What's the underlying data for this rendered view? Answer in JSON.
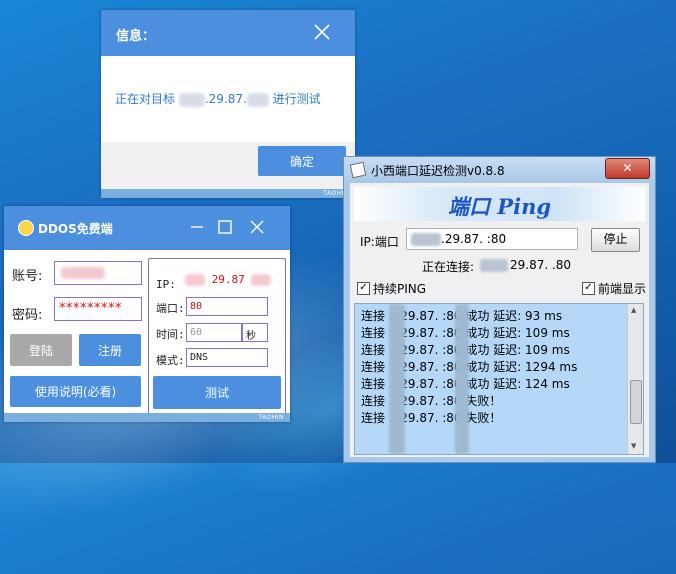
{
  "info_dialog": {
    "title": "信息：",
    "message_prefix": "正在对目标",
    "message_ip": ".29.87.",
    "message_suffix": "进行测试",
    "ok_label": "确定",
    "brand": "TAOHIN"
  },
  "ddos_window": {
    "title": "DDOS免费端",
    "account_label": "账号:",
    "password_label": "密码:",
    "password_value": "*********",
    "login_label": "登陆",
    "register_label": "注册",
    "help_label": "使用说明(必看)",
    "ip_label": "IP:",
    "ip_value": "29.87",
    "port_label": "端口:",
    "port_value": "80",
    "time_label": "时间:",
    "time_value": "60",
    "time_unit": "秒",
    "mode_label": "模式:",
    "mode_value": "DNS",
    "test_label": "测试",
    "brand": "TAOHIN"
  },
  "ping_tool": {
    "title": "小西端口延迟检测v0.8.8",
    "close_label": "✕",
    "banner": "端口 Ping",
    "ip_port_label": "IP:端口",
    "ip_port_value": ".29.87.  :80",
    "stop_label": "停止",
    "connecting_label": "正在连接:",
    "connecting_value": "29.87.  .80",
    "continuous_ping_label": "持续PING",
    "continuous_ping_checked": true,
    "front_display_label": "前端显示",
    "front_display_checked": true,
    "log": [
      "连接   .129.87.   :80 成功 延迟: 93 ms",
      "连接   .129.87.   :80 成功 延迟: 109 ms",
      "连接   .129.87.   :80 成功 延迟: 109 ms",
      "连接   .129.87.   :80 成功 延迟: 1294 ms",
      "连接   .129.87.   :80 成功 延迟: 124 ms",
      "连接   .129.87.   :80 失败！",
      "连接   .129.87.   :80 失败！"
    ]
  }
}
